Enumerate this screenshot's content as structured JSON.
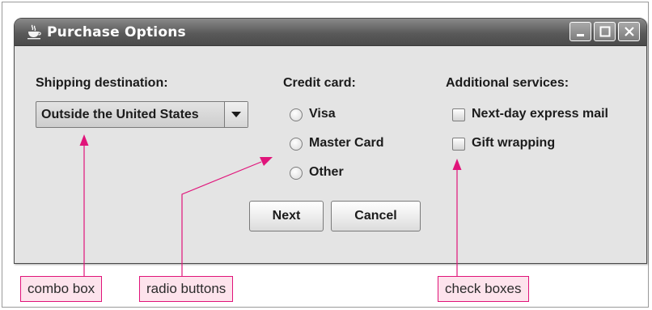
{
  "window": {
    "title": "Purchase Options",
    "app_icon": "java-coffee-cup-icon",
    "controls": [
      "minimize-icon",
      "maximize-icon",
      "close-icon"
    ]
  },
  "shipping": {
    "label": "Shipping destination:",
    "selected": "Outside the United States",
    "arrow_icon": "chevron-down-icon"
  },
  "credit_card": {
    "label": "Credit card:",
    "options": [
      {
        "label": "Visa",
        "selected": false
      },
      {
        "label": "Master Card",
        "selected": false
      },
      {
        "label": "Other",
        "selected": false
      }
    ]
  },
  "services": {
    "label": "Additional services:",
    "options": [
      {
        "label": "Next-day express mail",
        "checked": false
      },
      {
        "label": "Gift wrapping",
        "checked": false
      }
    ]
  },
  "buttons": {
    "next": "Next",
    "cancel": "Cancel"
  },
  "annotations": {
    "combo_box": "combo box",
    "radio_buttons": "radio buttons",
    "check_boxes": "check boxes",
    "color": "#e0147a"
  }
}
